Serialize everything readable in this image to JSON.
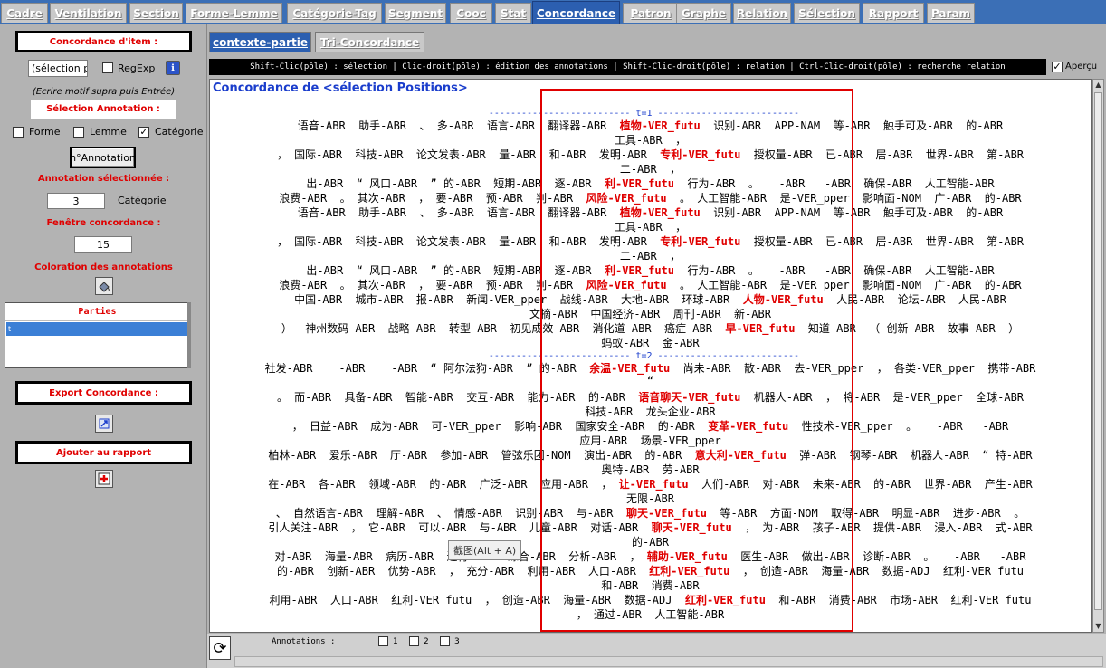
{
  "top_tabs": [
    {
      "label": "Cadre",
      "active": false
    },
    {
      "label": "Ventilation",
      "active": false
    },
    {
      "label": "Section",
      "active": false
    },
    {
      "label": "Forme-Lemme",
      "active": false
    },
    {
      "label": "Catégorie-Tag",
      "active": false
    },
    {
      "label": "Segment",
      "active": false
    },
    {
      "label": "Cooc",
      "active": false
    },
    {
      "label": "Stat",
      "active": false
    },
    {
      "label": "Concordance",
      "active": true
    },
    {
      "label": "Patron",
      "active": false
    },
    {
      "label": "Graphe",
      "active": false
    },
    {
      "label": "Relation",
      "active": false
    },
    {
      "label": "Sélection",
      "active": false
    },
    {
      "label": "Rapport",
      "active": false
    },
    {
      "label": "Param",
      "active": false
    }
  ],
  "left": {
    "concordance_item_title": "Concordance d'item :",
    "search_value": "(sélection po",
    "regexp_label": "RegExp",
    "regexp_checked": false,
    "info_icon": "ℹ",
    "hint": "(Ecrire motif supra puis Entrée)",
    "selection_annotation_title": "Sélection Annotation :",
    "forme_label": "Forme",
    "forme_checked": false,
    "lemme_label": "Lemme",
    "lemme_checked": false,
    "categorie_label": "Catégorie",
    "categorie_checked": true,
    "nannotation_button": "n°Annotation",
    "annotation_selected_title": "Annotation sélectionnée :",
    "annotation_value": "3",
    "annotation_cat_label": "Catégorie",
    "fenetre_title": "Fenêtre concordance :",
    "fenetre_value": "15",
    "coloration_title": "Coloration des annotations",
    "parties_title": "Parties",
    "parties_row": "t",
    "export_title": "Export Concordance :",
    "ajouter_title": "Ajouter au rapport"
  },
  "subtabs": [
    {
      "label": "contexte-partie",
      "active": true
    },
    {
      "label": "Tri-Concordance",
      "active": false
    }
  ],
  "infobar": "Shift-Clic(pôle) : sélection | Clic-droit(pôle) : édition des annotations | Shift-Clic-droit(pôle) : relation | Ctrl-Clic-droit(pôle) : recherche relation",
  "apercu_label": "Aperçu",
  "apercu_checked": true,
  "concordance_title": "Concordance de <sélection Positions>",
  "sections": [
    {
      "label": "t=1",
      "lines": [
        [
          "语音-ABR  助手-ABR  、 多-ABR  语言-ABR  翻译器-ABR  ",
          "植物-VER_futu",
          "  识别-ABR  APP-NAM  等-ABR  触手可及-ABR  的-ABR"
        ],
        [
          "工具-ABR  ，",
          "",
          ""
        ],
        [
          "， 国际-ABR  科技-ABR  论文发表-ABR  量-ABR  和-ABR  发明-ABR  ",
          "专利-VER_futu",
          "  授权量-ABR  已-ABR  居-ABR  世界-ABR  第-ABR"
        ],
        [
          "二-ABR  ，",
          "",
          ""
        ],
        [
          "出-ABR  “ 风口-ABR  ” 的-ABR  短期-ABR  逐-ABR  ",
          "利-VER_futu",
          "  行为-ABR  。   -ABR   -ABR  确保-ABR  人工智能-ABR"
        ],
        [
          "浪费-ABR  。 其次-ABR  ， 要-ABR  预-ABR  判-ABR  ",
          "风险-VER_futu",
          "  。 人工智能-ABR  是-VER_pper  影响面-NOM  广-ABR  的-ABR"
        ],
        [
          "语音-ABR  助手-ABR  、 多-ABR  语言-ABR  翻译器-ABR  ",
          "植物-VER_futu",
          "  识别-ABR  APP-NAM  等-ABR  触手可及-ABR  的-ABR"
        ],
        [
          "工具-ABR  ，",
          "",
          ""
        ],
        [
          "， 国际-ABR  科技-ABR  论文发表-ABR  量-ABR  和-ABR  发明-ABR  ",
          "专利-VER_futu",
          "  授权量-ABR  已-ABR  居-ABR  世界-ABR  第-ABR"
        ],
        [
          "二-ABR  ，",
          "",
          ""
        ],
        [
          "出-ABR  “ 风口-ABR  ” 的-ABR  短期-ABR  逐-ABR  ",
          "利-VER_futu",
          "  行为-ABR  。   -ABR   -ABR  确保-ABR  人工智能-ABR"
        ],
        [
          "浪费-ABR  。 其次-ABR  ， 要-ABR  预-ABR  判-ABR  ",
          "风险-VER_futu",
          "  。 人工智能-ABR  是-VER_pper  影响面-NOM  广-ABR  的-ABR"
        ],
        [
          "中国-ABR  城市-ABR  报-ABR  新闻-VER_pper  战线-ABR  大地-ABR  环球-ABR  ",
          "人物-VER_futu",
          "  人民-ABR  论坛-ABR  人民-ABR"
        ],
        [
          "文摘-ABR  中国经济-ABR  周刊-ABR  新-ABR",
          "",
          ""
        ],
        [
          "）  神州数码-ABR  战略-ABR  转型-ABR  初见成效-ABR  消化道-ABR  癌症-ABR  ",
          "早-VER_futu",
          "  知道-ABR  （ 创新-ABR  故事-ABR  ）"
        ],
        [
          "蚂蚁-ABR  金-ABR",
          "",
          ""
        ]
      ]
    },
    {
      "label": "t=2",
      "lines": [
        [
          "社发-ABR    -ABR    -ABR  “ 阿尔法狗-ABR  ” 的-ABR  ",
          "余温-VER_futu",
          "  尚未-ABR  散-ABR  去-VER_pper  ， 各类-VER_pper  携带-ABR"
        ],
        [
          "“",
          "",
          ""
        ],
        [
          "。 而-ABR  具备-ABR  智能-ABR  交互-ABR  能力-ABR  的-ABR  ",
          "语音聊天-VER_futu",
          "  机器人-ABR  ， 将-ABR  是-VER_pper  全球-ABR"
        ],
        [
          "科技-ABR  龙头企业-ABR",
          "",
          ""
        ],
        [
          "， 日益-ABR  成为-ABR  可-VER_pper  影响-ABR  国家安全-ABR  的-ABR  ",
          "变革-VER_futu",
          "  性技术-VER_pper  。   -ABR   -ABR"
        ],
        [
          "应用-ABR  场景-VER_pper",
          "",
          ""
        ],
        [
          "柏林-ABR  爱乐-ABR  厅-ABR  参加-ABR  管弦乐团-NOM  演出-ABR  的-ABR  ",
          "意大利-VER_futu",
          "  弹-ABR  钢琴-ABR  机器人-ABR  “ 特-ABR"
        ],
        [
          "奥特-ABR  劳-ABR",
          "",
          ""
        ],
        [
          "在-ABR  各-ABR  领域-ABR  的-ABR  广泛-ABR  应用-ABR  ， ",
          "让-VER_futu",
          "  人们-ABR  对-ABR  未来-ABR  的-ABR  世界-ABR  产生-ABR"
        ],
        [
          "无限-ABR",
          "",
          ""
        ],
        [
          "、 自然语言-ABR  理解-ABR  、 情感-ABR  识别-ABR  与-ABR  ",
          "聊天-VER_futu",
          "  等-ABR  方面-NOM  取得-ABR  明显-ABR  进步-ABR  。"
        ],
        [
          "引人关注-ABR  ， 它-ABR  可以-ABR  与-ABR  儿童-ABR  对话-ABR  ",
          "聊天-VER_futu",
          "  ， 为-ABR  孩子-ABR  提供-ABR  浸入-ABR  式-ABR"
        ],
        [
          "的-ABR",
          "",
          ""
        ],
        [
          "对-ABR  海量-ABR  病历-ABR  进行-ABR  综合-ABR  分析-ABR  ， ",
          "辅助-VER_futu",
          "  医生-ABR  做出-ABR  诊断-ABR  。   -ABR   -ABR"
        ],
        [
          "的-ABR  创新-ABR  优势-ABR  ， 充分-ABR  利用-ABR  人口-ABR  ",
          "红利-VER_futu",
          "  ， 创造-ABR  海量-ABR  数据-ADJ  红利-VER_futu"
        ],
        [
          "和-ABR  消费-ABR",
          "",
          ""
        ],
        [
          "利用-ABR  人口-ABR  红利-VER_futu  ， 创造-ABR  海量-ABR  数据-ADJ  ",
          "红利-VER_futu",
          "  和-ABR  消费-ABR  市场-ABR  红利-VER_futu"
        ],
        [
          "， 通过-ABR  人工智能-ABR",
          "",
          ""
        ]
      ]
    }
  ],
  "tooltip": "截图(Alt + A)",
  "bottom": {
    "annotations_label": "Annotations :",
    "checks": [
      "1",
      "2",
      "3"
    ]
  }
}
